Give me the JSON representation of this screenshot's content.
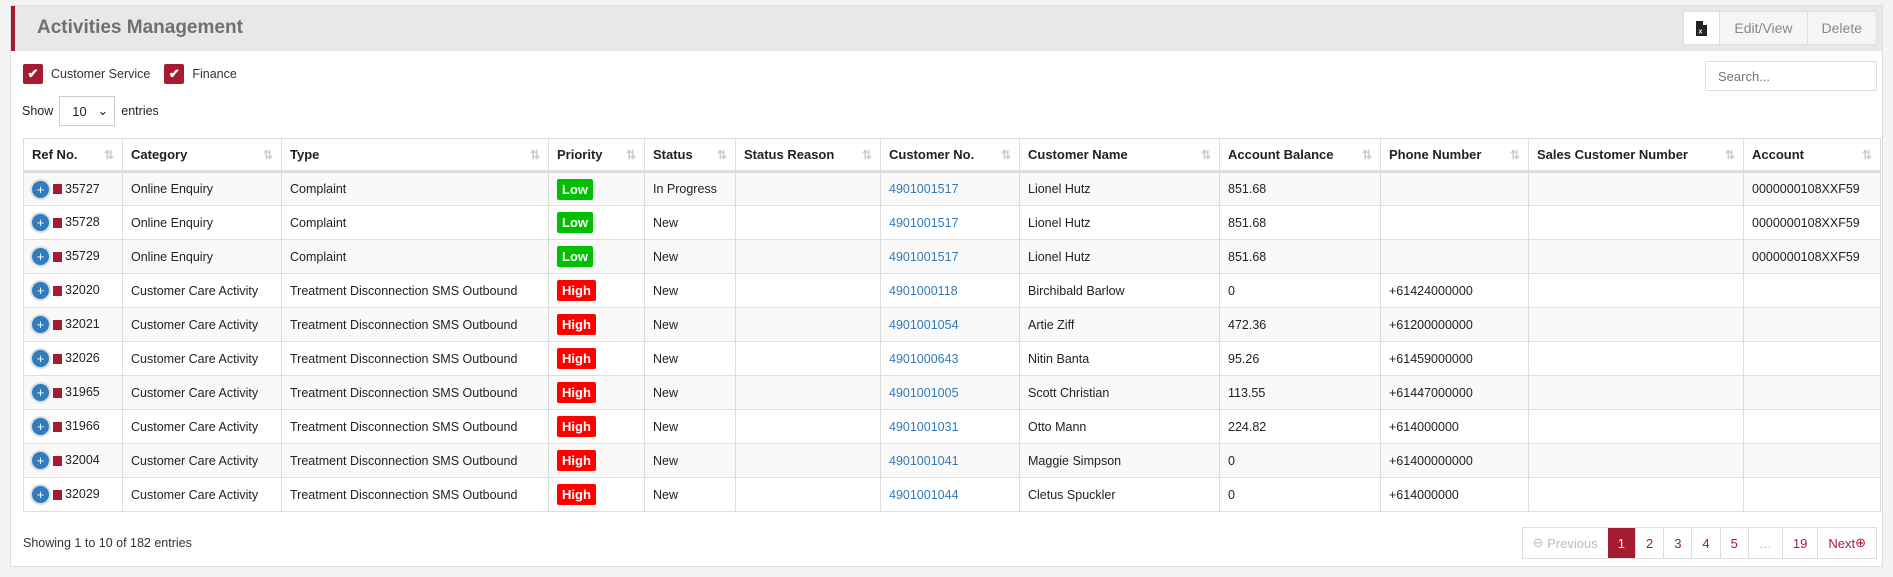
{
  "title": "Activities Management",
  "toolbar": {
    "export_icon": "excel-file-icon",
    "edit_label": "Edit/View",
    "delete_label": "Delete"
  },
  "filters": [
    {
      "label": "Customer Service",
      "checked": true
    },
    {
      "label": "Finance",
      "checked": true
    }
  ],
  "search": {
    "placeholder": "Search...",
    "value": ""
  },
  "length": {
    "show_label": "Show",
    "value": "10",
    "entries_label": "entries"
  },
  "columns": [
    "Ref No.",
    "Category",
    "Type",
    "Priority",
    "Status",
    "Status Reason",
    "Customer No.",
    "Customer Name",
    "Account Balance",
    "Phone Number",
    "Sales Customer Number",
    "Account"
  ],
  "priority_colors": {
    "Low": "#00c000",
    "High": "#ff0000"
  },
  "rows": [
    {
      "ref": "35727",
      "category": "Online Enquiry",
      "type": "Complaint",
      "priority": "Low",
      "status": "In Progress",
      "reason": "",
      "customer_no": "4901001517",
      "customer_name": "Lionel Hutz",
      "balance": "851.68",
      "phone": "",
      "sales_no": "",
      "account": "0000000108XXF59"
    },
    {
      "ref": "35728",
      "category": "Online Enquiry",
      "type": "Complaint",
      "priority": "Low",
      "status": "New",
      "reason": "",
      "customer_no": "4901001517",
      "customer_name": "Lionel Hutz",
      "balance": "851.68",
      "phone": "",
      "sales_no": "",
      "account": "0000000108XXF59"
    },
    {
      "ref": "35729",
      "category": "Online Enquiry",
      "type": "Complaint",
      "priority": "Low",
      "status": "New",
      "reason": "",
      "customer_no": "4901001517",
      "customer_name": "Lionel Hutz",
      "balance": "851.68",
      "phone": "",
      "sales_no": "",
      "account": "0000000108XXF59"
    },
    {
      "ref": "32020",
      "category": "Customer Care Activity",
      "type": "Treatment Disconnection SMS Outbound",
      "priority": "High",
      "status": "New",
      "reason": "",
      "customer_no": "4901000118",
      "customer_name": "Birchibald Barlow",
      "balance": "0",
      "phone": "+61424000000",
      "sales_no": "",
      "account": ""
    },
    {
      "ref": "32021",
      "category": "Customer Care Activity",
      "type": "Treatment Disconnection SMS Outbound",
      "priority": "High",
      "status": "New",
      "reason": "",
      "customer_no": "4901001054",
      "customer_name": "Artie Ziff",
      "balance": "472.36",
      "phone": "+61200000000",
      "sales_no": "",
      "account": ""
    },
    {
      "ref": "32026",
      "category": "Customer Care Activity",
      "type": "Treatment Disconnection SMS Outbound",
      "priority": "High",
      "status": "New",
      "reason": "",
      "customer_no": "4901000643",
      "customer_name": "Nitin Banta",
      "balance": "95.26",
      "phone": "+61459000000",
      "sales_no": "",
      "account": ""
    },
    {
      "ref": "31965",
      "category": "Customer Care Activity",
      "type": "Treatment Disconnection SMS Outbound",
      "priority": "High",
      "status": "New",
      "reason": "",
      "customer_no": "4901001005",
      "customer_name": "Scott Christian",
      "balance": "113.55",
      "phone": "+61447000000",
      "sales_no": "",
      "account": ""
    },
    {
      "ref": "31966",
      "category": "Customer Care Activity",
      "type": "Treatment Disconnection SMS Outbound",
      "priority": "High",
      "status": "New",
      "reason": "",
      "customer_no": "4901001031",
      "customer_name": "Otto Mann",
      "balance": "224.82",
      "phone": "+614000000",
      "sales_no": "",
      "account": ""
    },
    {
      "ref": "32004",
      "category": "Customer Care Activity",
      "type": "Treatment Disconnection SMS Outbound",
      "priority": "High",
      "status": "New",
      "reason": "",
      "customer_no": "4901001041",
      "customer_name": "Maggie Simpson",
      "balance": "0",
      "phone": "+61400000000",
      "sales_no": "",
      "account": ""
    },
    {
      "ref": "32029",
      "category": "Customer Care Activity",
      "type": "Treatment Disconnection SMS Outbound",
      "priority": "High",
      "status": "New",
      "reason": "",
      "customer_no": "4901001044",
      "customer_name": "Cletus Spuckler",
      "balance": "0",
      "phone": "+614000000",
      "sales_no": "",
      "account": ""
    }
  ],
  "info": "Showing 1 to 10 of 182 entries",
  "pagination": {
    "previous": "Previous",
    "pages": [
      "1",
      "2",
      "3",
      "4",
      "5",
      "…",
      "19"
    ],
    "current": "1",
    "next": "Next"
  }
}
